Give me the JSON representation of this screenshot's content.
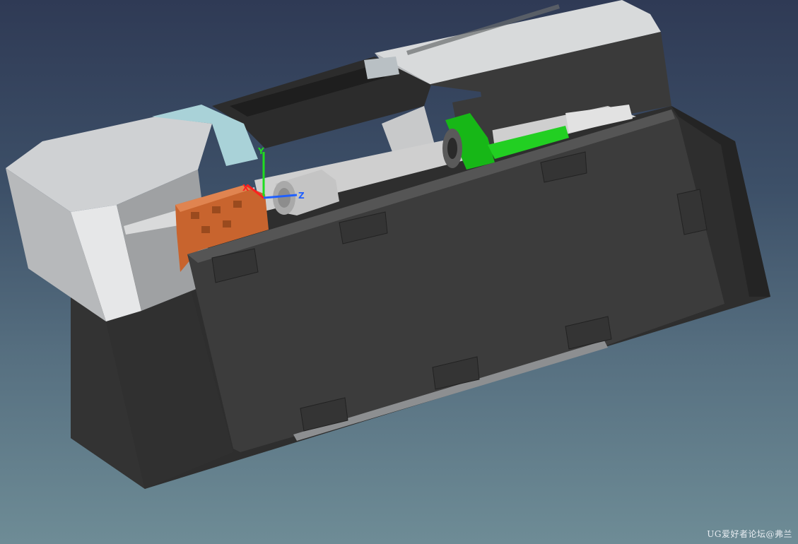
{
  "viewport": {
    "background_top": "#2f3a55",
    "background_bottom": "#6e8c96"
  },
  "model": {
    "parts": [
      {
        "name": "machine-enclosure",
        "color": "#3a3a3a"
      },
      {
        "name": "front-door-panel",
        "color": "#3c3c3c"
      },
      {
        "name": "top-cover-left",
        "color": "#9a9c9e"
      },
      {
        "name": "top-cover-right",
        "color": "#a7a9ab"
      },
      {
        "name": "tail-stock",
        "color": "#1fc21f"
      },
      {
        "name": "headstock-housing",
        "color": "#c8642e"
      },
      {
        "name": "spindle-chuck",
        "color": "#bdbdbd"
      },
      {
        "name": "side-cover",
        "color": "#6c8a95"
      }
    ],
    "nameplate_icon": "engraved-nameplate"
  },
  "triad": {
    "x_label": "X",
    "y_label": "Y",
    "z_label": "Z",
    "x_color": "#ff2020",
    "y_color": "#20dd20",
    "z_color": "#2060ff"
  },
  "watermark": {
    "text": "UG爱好者论坛@弗兰"
  }
}
